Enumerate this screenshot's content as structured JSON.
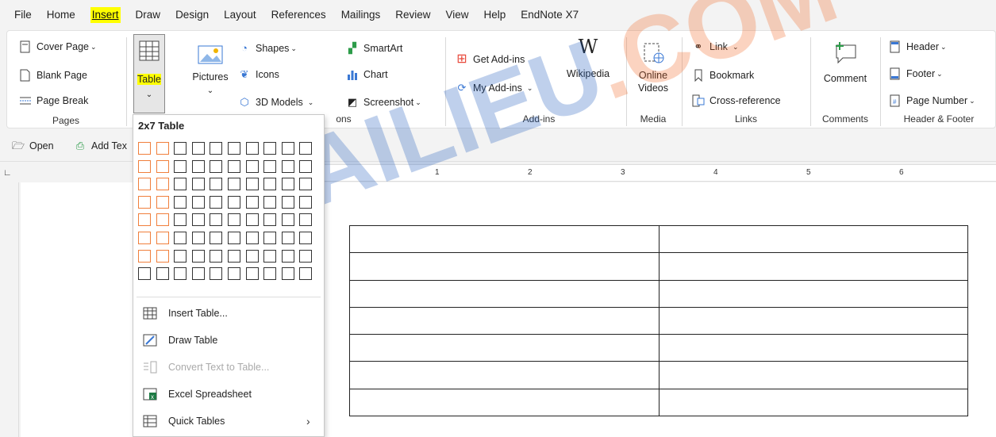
{
  "menu": {
    "tabs": [
      "File",
      "Home",
      "Insert",
      "Draw",
      "Design",
      "Layout",
      "References",
      "Mailings",
      "Review",
      "View",
      "Help",
      "EndNote X7"
    ],
    "active_tab": "Insert"
  },
  "ribbon": {
    "pages": {
      "label": "Pages",
      "cover_page": "Cover Page",
      "blank_page": "Blank Page",
      "page_break": "Page Break"
    },
    "tables": {
      "table": "Table"
    },
    "illustrations": {
      "label": "ons",
      "pictures": "Pictures",
      "shapes": "Shapes",
      "icons": "Icons",
      "models": "3D Models",
      "smartart": "SmartArt",
      "chart": "Chart",
      "screenshot": "Screenshot"
    },
    "addins": {
      "label": "Add-ins",
      "get": "Get Add-ins",
      "my": "My Add-ins",
      "wikipedia": "Wikipedia"
    },
    "media": {
      "label": "Media",
      "online_videos": "Online Videos"
    },
    "links": {
      "label": "Links",
      "link": "Link",
      "bookmark": "Bookmark",
      "cross_reference": "Cross-reference"
    },
    "comments": {
      "label": "Comments",
      "comment": "Comment"
    },
    "header_footer": {
      "label": "Header & Footer",
      "header": "Header",
      "footer": "Footer",
      "page_number": "Page Number"
    }
  },
  "quick_access": {
    "open": "Open",
    "add_text": "Add Tex"
  },
  "table_menu": {
    "title": "2x7 Table",
    "grid_cols": 10,
    "grid_rows": 8,
    "selected_cols": 2,
    "selected_rows": 7,
    "items": [
      {
        "label": "Insert Table...",
        "enabled": true
      },
      {
        "label": "Draw Table",
        "enabled": true
      },
      {
        "label": "Convert Text to Table...",
        "enabled": false
      },
      {
        "label": "Excel Spreadsheet",
        "enabled": true
      },
      {
        "label": "Quick Tables",
        "enabled": true,
        "submenu": true
      }
    ]
  },
  "document": {
    "table_rows": 7,
    "table_cols": 2
  },
  "ruler": {
    "marks": [
      "1",
      "2",
      "3",
      "4",
      "5",
      "6"
    ]
  },
  "watermark": {
    "part1": "TAILIEU",
    "part2": ".COM"
  },
  "colors": {
    "accent_orange": "#f07f3c",
    "highlight": "#ffff00"
  }
}
